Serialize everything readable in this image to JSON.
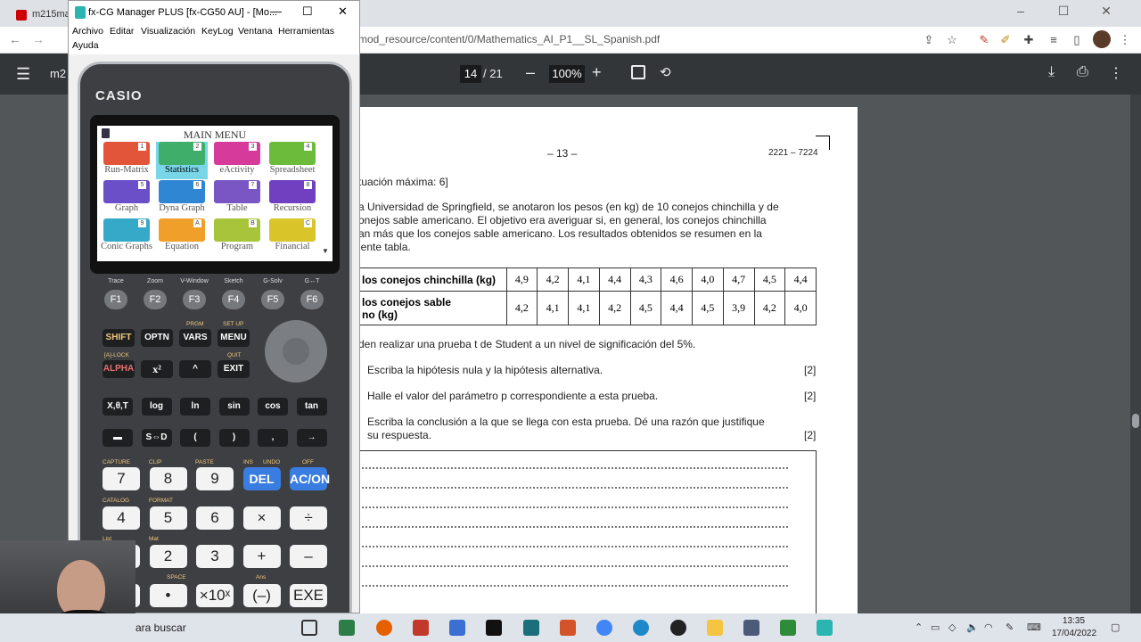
{
  "browser": {
    "tab_title": "m215ma",
    "url": "mod_resource/content/0/Mathematics_AI_P1__SL_Spanish.pdf",
    "window_controls": [
      "–",
      "☐",
      "✕"
    ]
  },
  "pdf_toolbar": {
    "title": "m2",
    "page_current": "14",
    "page_total": "/ 21",
    "zoom": "100%",
    "zoom_out": "–",
    "zoom_in": "+"
  },
  "pdf_page": {
    "page_number": "– 13 –",
    "code": "2221 – 7224",
    "max_score": "tuación máxima: 6]",
    "intro_lines": [
      "a Universidad de Springfield, se anotaron los pesos (en kg) de 10 conejos chinchilla y de",
      "onejos sable americano. El objetivo era averiguar si, en general, los conejos chinchilla",
      "an más que los conejos sable americano. Los resultados obtenidos se resumen en la",
      "iente tabla."
    ],
    "table": {
      "row1_label": "los conejos chinchilla (kg)",
      "row1_values": [
        "4,9",
        "4,2",
        "4,1",
        "4,4",
        "4,3",
        "4,6",
        "4,0",
        "4,7",
        "4,5",
        "4,4"
      ],
      "row2_label_line1": "los conejos sable",
      "row2_label_line2": "no (kg)",
      "row2_values": [
        "4,2",
        "4,1",
        "4,1",
        "4,2",
        "4,5",
        "4,4",
        "4,5",
        "3,9",
        "4,2",
        "4,0"
      ]
    },
    "test_line": "den realizar una prueba t de Student a un nivel de significación del 5%.",
    "questions": [
      {
        "text": "Escriba la hipótesis nula y la hipótesis alternativa.",
        "marks": "[2]"
      },
      {
        "text": "Halle el valor del parámetro p correspondiente a esta prueba.",
        "marks": "[2]"
      },
      {
        "text_line1": "Escriba la conclusión a la que se llega con esta prueba. Dé una razón que justifique",
        "text_line2": "su respuesta.",
        "marks": "[2]"
      }
    ]
  },
  "calculator_window": {
    "title": "fx-CG Manager PLUS [fx-CG50 AU] - [Mo...",
    "menu": [
      "Archivo",
      "Editar",
      "Visualización",
      "KeyLog",
      "Ventana",
      "Herramientas",
      "Ayuda"
    ],
    "brand": "CASIO",
    "screen_title": "MAIN MENU",
    "apps": [
      {
        "label": "Run-Matrix",
        "num": "1",
        "color": "#e2553a",
        "selected": false
      },
      {
        "label": "Statistics",
        "num": "2",
        "color": "#3fae6a",
        "selected": true
      },
      {
        "label": "eActivity",
        "num": "3",
        "color": "#d63a9a",
        "selected": false
      },
      {
        "label": "Spreadsheet",
        "num": "4",
        "color": "#6dbb3a",
        "selected": false
      },
      {
        "label": "Graph",
        "num": "5",
        "color": "#6a4fc9",
        "selected": false
      },
      {
        "label": "Dyna Graph",
        "num": "6",
        "color": "#2f86d2",
        "selected": false
      },
      {
        "label": "Table",
        "num": "7",
        "color": "#7a55c4",
        "selected": false
      },
      {
        "label": "Recursion",
        "num": "8",
        "color": "#7040c0",
        "selected": false
      },
      {
        "label": "Conic Graphs",
        "num": "9",
        "color": "#36a9c9",
        "selected": false
      },
      {
        "label": "Equation",
        "num": "A",
        "color": "#f0a02a",
        "selected": false
      },
      {
        "label": "Program",
        "num": "B",
        "color": "#a7c43a",
        "selected": false
      },
      {
        "label": "Financial",
        "num": "C",
        "color": "#d9c52a",
        "selected": false
      }
    ],
    "fkeys": [
      {
        "label": "F1",
        "top": "Trace"
      },
      {
        "label": "F2",
        "top": "Zoom"
      },
      {
        "label": "F3",
        "top": "V-Window"
      },
      {
        "label": "F4",
        "top": "Sketch"
      },
      {
        "label": "F5",
        "top": "G-Solv"
      },
      {
        "label": "F6",
        "top": "G↔T"
      }
    ],
    "row1_keys": [
      "SHIFT",
      "OPTN",
      "VARS",
      "MENU"
    ],
    "row2_keys": [
      "ALPHA",
      "x²",
      "^",
      "EXIT"
    ],
    "row3_keys": [
      "X,θ,T",
      "log",
      "ln",
      "sin",
      "cos",
      "tan"
    ],
    "row4_keys": [
      "▬",
      "S⇔D",
      "(",
      ")",
      ",",
      "→"
    ],
    "num_row1": [
      "7",
      "8",
      "9",
      "DEL",
      "AC/ON"
    ],
    "num_row2": [
      "4",
      "5",
      "6",
      "×",
      "÷"
    ],
    "num_row3": [
      "1",
      "2",
      "3",
      "+",
      "–"
    ],
    "num_row4": [
      "0",
      "•",
      "×10ˣ",
      "(–)",
      "EXE"
    ],
    "shift_labels": {
      "prgm": "PRGM",
      "setup": "SET UP",
      "alock": "[A]-LOCK",
      "quit": "QUIT",
      "capture": "CAPTURE",
      "clip": "CLIP",
      "paste": "PASTE",
      "ins": "INS",
      "undo": "UNDO",
      "off": "OFF",
      "catalog": "CATALOG",
      "format": "FORMAT",
      "mat": "Mat",
      "list": "List",
      "space": "SPACE",
      "ans": "Ans"
    }
  },
  "taskbar": {
    "search": "ara buscar",
    "time": "13:35",
    "date": "17/04/2022"
  }
}
